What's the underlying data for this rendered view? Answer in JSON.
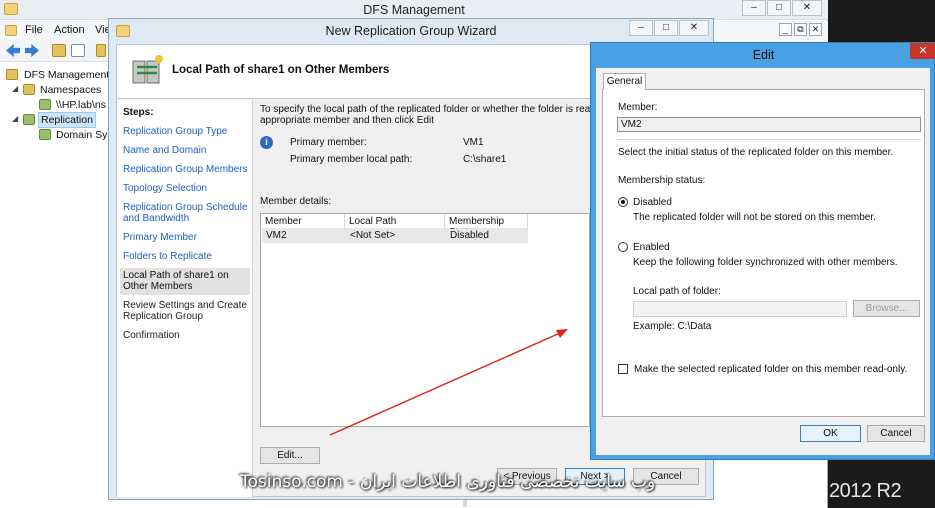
{
  "dfs_window": {
    "title": "DFS Management",
    "menu": [
      "File",
      "Action",
      "Vie"
    ],
    "tree": [
      {
        "label": "DFS Management"
      },
      {
        "label": "Namespaces"
      },
      {
        "label": "\\\\HP.lab\\ns"
      },
      {
        "label": "Replication"
      },
      {
        "label": "Domain Sys"
      }
    ]
  },
  "wizard": {
    "title": "New Replication Group Wizard",
    "header_title": "Local Path of share1 on Other Members",
    "steps_title": "Steps:",
    "steps": [
      {
        "label": "Replication Group Type"
      },
      {
        "label": "Name and Domain"
      },
      {
        "label": "Replication Group Members"
      },
      {
        "label": "Topology Selection"
      },
      {
        "label": "Replication Group Schedule and Bandwidth"
      },
      {
        "label": "Primary Member"
      },
      {
        "label": "Folders to Replicate"
      },
      {
        "label": "Local Path of share1 on Other Members"
      },
      {
        "label": "Review Settings and Create Replication Group"
      },
      {
        "label": "Confirmation"
      }
    ],
    "description": "To specify the local path of the replicated folder or whether the folder is read-only, select the appropriate member and then click Edit",
    "primary_member_label": "Primary member:",
    "primary_member_value": "VM1",
    "primary_path_label": "Primary member local path:",
    "primary_path_value": "C:\\share1",
    "member_details_label": "Member details:",
    "columns": [
      "Member",
      "Local Path",
      "Membership Stat..."
    ],
    "rows": [
      {
        "member": "VM2",
        "local_path": "<Not Set>",
        "status": "Disabled"
      }
    ],
    "edit_button": "Edit...",
    "previous_button": "< Previous",
    "next_button": "Next >",
    "cancel_button": "Cancel"
  },
  "edit_dialog": {
    "title": "Edit",
    "tab": "General",
    "member_label": "Member:",
    "member_value": "VM2",
    "instruction": "Select the initial status of the replicated folder on this member.",
    "membership_status_label": "Membership status:",
    "disabled_label": "Disabled",
    "disabled_desc": "The replicated folder will not be stored on this member.",
    "enabled_label": "Enabled",
    "enabled_desc": "Keep the following folder synchronized with other members.",
    "local_path_label": "Local path of folder:",
    "local_path_value": "",
    "browse_button": "Browse...",
    "example": "Example: C:\\Data",
    "readonly_label": "Make the selected replicated folder on this member read-only.",
    "ok_button": "OK",
    "cancel_button": "Cancel",
    "selected_status": "Disabled",
    "readonly_checked": false
  },
  "desktop": {
    "os_label": "2012 R2"
  },
  "watermark": "وب سایت تخصصی فناوری اطلاعات ایران - Tosinso.com",
  "colors": {
    "accent": "#4aa0e2",
    "close": "#c8352b",
    "link": "#1f5fbf",
    "arrow": "#e0201a"
  }
}
